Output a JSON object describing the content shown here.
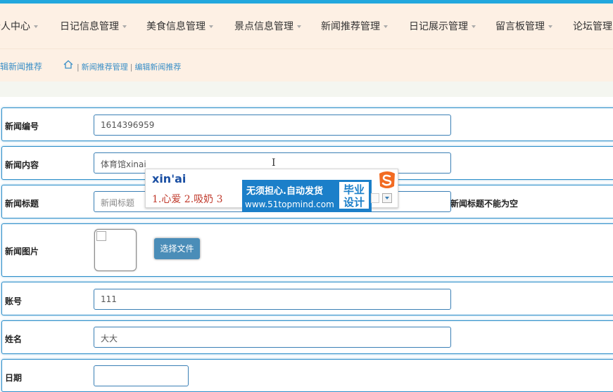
{
  "nav": {
    "items": [
      {
        "label": "个人中心"
      },
      {
        "label": "日记信息管理"
      },
      {
        "label": "美食信息管理"
      },
      {
        "label": "景点信息管理"
      },
      {
        "label": "新闻推荐管理"
      },
      {
        "label": "日记展示管理"
      },
      {
        "label": "留言板管理"
      },
      {
        "label": "论坛管理"
      }
    ]
  },
  "breadcrumb": {
    "title": "编辑新闻推荐",
    "home_icon": "home-icon",
    "path": [
      "新闻推荐管理",
      "编辑新闻推荐"
    ]
  },
  "form": {
    "news_id": {
      "label": "新闻编号",
      "value": "1614396959"
    },
    "news_content": {
      "label": "新闻内容",
      "value": "体育馆xinai"
    },
    "news_title": {
      "label": "新闻标题",
      "placeholder": "新闻标题",
      "error": "新闻标题不能为空"
    },
    "news_image": {
      "label": "新闻图片",
      "button": "选择文件"
    },
    "account": {
      "label": "账号",
      "value": "111"
    },
    "name": {
      "label": "姓名",
      "value": "大大"
    },
    "date": {
      "label": "日期",
      "value": ""
    }
  },
  "ime": {
    "pinyin": "xin'ai",
    "candidates": "1.心爱  2.吸奶  3",
    "ad_line1": "无须担心.自动发货",
    "ad_line2": "www.51topmind.com",
    "ad_tag": "毕业设计",
    "logo_icon": "sogou-s-icon"
  },
  "colors": {
    "accent": "#22a7dd",
    "nav_bg": "#fdf0e4",
    "link": "#3a8fc7",
    "field_border": "#3a7fb5",
    "button_bg": "#4a8db8"
  }
}
